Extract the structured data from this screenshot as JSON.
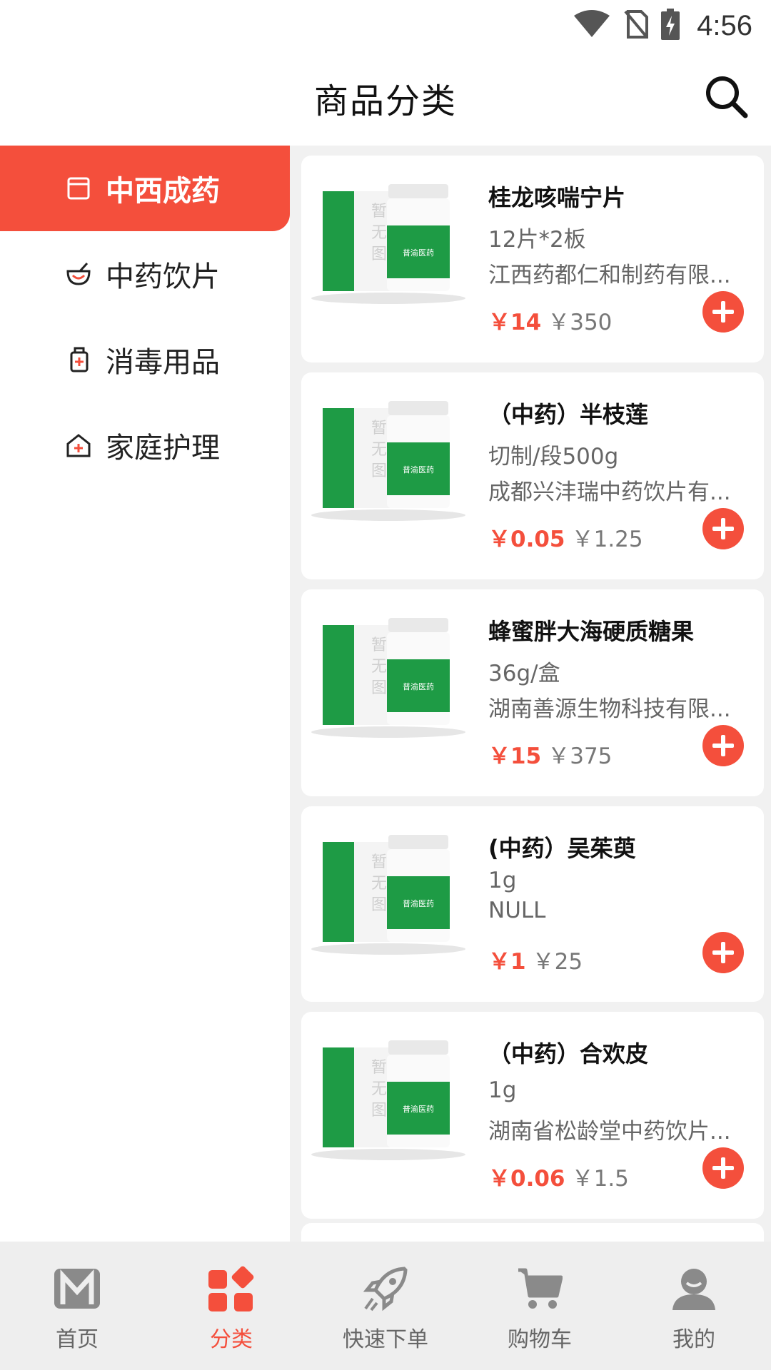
{
  "status_bar": {
    "time": "4:56"
  },
  "header": {
    "title": "商品分类"
  },
  "sidebar": {
    "items": [
      {
        "label": "中西成药",
        "active": true
      },
      {
        "label": "中药饮片",
        "active": false
      },
      {
        "label": "消毒用品",
        "active": false
      },
      {
        "label": "家庭护理",
        "active": false
      }
    ]
  },
  "placeholder_image": {
    "text": [
      "暂",
      "无",
      "图"
    ],
    "brand": "普渝医药"
  },
  "products": [
    {
      "name": "桂龙咳喘宁片",
      "spec": "12片*2板",
      "maker": "江西药都仁和制药有限...",
      "price": "￥14",
      "original_price": "￥350"
    },
    {
      "name": "（中药）半枝莲",
      "spec": "切制/段500g",
      "maker": "成都兴沣瑞中药饮片有...",
      "price": "￥0.05",
      "original_price": "￥1.25"
    },
    {
      "name": "蜂蜜胖大海硬质糖果",
      "spec": "36g/盒",
      "maker": "湖南善源生物科技有限...",
      "price": "￥15",
      "original_price": "￥375"
    },
    {
      "name": "(中药）吴茱萸",
      "spec": "1g",
      "maker": "NULL",
      "price": "￥1",
      "original_price": "￥25"
    },
    {
      "name": "（中药）合欢皮",
      "spec": "1g",
      "maker": "湖南省松龄堂中药饮片...",
      "price": "￥0.06",
      "original_price": "￥1.5"
    }
  ],
  "bottom_nav": {
    "items": [
      {
        "label": "首页",
        "icon": "home-icon",
        "active": false
      },
      {
        "label": "分类",
        "icon": "category-icon",
        "active": true
      },
      {
        "label": "快速下单",
        "icon": "rocket-icon",
        "active": false
      },
      {
        "label": "购物车",
        "icon": "cart-icon",
        "active": false
      },
      {
        "label": "我的",
        "icon": "user-icon",
        "active": false
      }
    ]
  },
  "colors": {
    "accent": "#f44f3c",
    "nav_bg": "#eeeeee",
    "list_bg": "#f1f1f1",
    "inactive_icon": "#8a8a8a"
  }
}
